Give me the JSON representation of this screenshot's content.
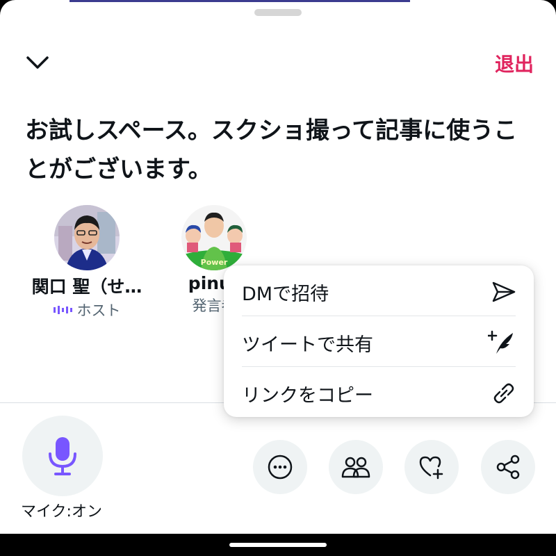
{
  "header": {
    "leave_label": "退出"
  },
  "space": {
    "title": "お試しスペース。スクショ撮って記事に使うことがございます。"
  },
  "speakers": [
    {
      "name": "関口 聖（せ…",
      "role": "ホスト"
    },
    {
      "name": "pinur",
      "role": "発言者",
      "avatar_text": "Power"
    }
  ],
  "mic": {
    "label": "マイク:オン"
  },
  "share_menu": {
    "items": [
      {
        "label": "DMで招待",
        "icon": "send-icon"
      },
      {
        "label": "ツイートで共有",
        "icon": "compose-tweet-icon"
      },
      {
        "label": "リンクをコピー",
        "icon": "link-icon"
      }
    ]
  },
  "colors": {
    "accent_red": "#e0245e",
    "accent_purple": "#7856ff",
    "text": "#0f1419",
    "secondary": "#536471",
    "button_bg": "#eff3f4"
  },
  "actions": [
    {
      "icon": "more-icon"
    },
    {
      "icon": "people-icon"
    },
    {
      "icon": "heart-plus-icon"
    },
    {
      "icon": "share-icon"
    }
  ]
}
